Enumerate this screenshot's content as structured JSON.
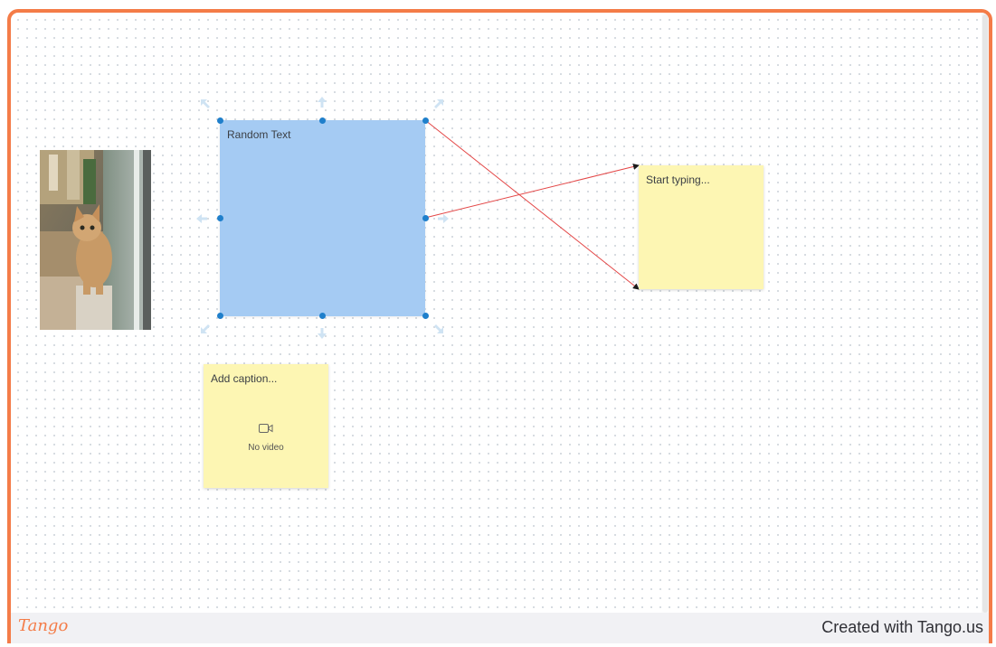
{
  "canvas": {
    "accent_color": "#f47c48",
    "background_color": "#ffffff",
    "grid_dot_color": "#d4d9df"
  },
  "shape": {
    "text": "Random Text",
    "fill_color": "#a5cbf3",
    "handle_color": "#1f7fcb",
    "selected": true
  },
  "sticky_notes": [
    {
      "text": "Start typing...",
      "color": "#fdf6b3"
    },
    {
      "text": "Add caption...",
      "video_placeholder": "No video",
      "icon": "video-camera-icon",
      "color": "#fdf6b3"
    }
  ],
  "image": {
    "subject": "kitten",
    "icon": "photo-icon"
  },
  "connectors": {
    "color": "#e34646",
    "count": 2
  },
  "footer": {
    "logo": "Tango",
    "credit": "Created with Tango.us"
  }
}
